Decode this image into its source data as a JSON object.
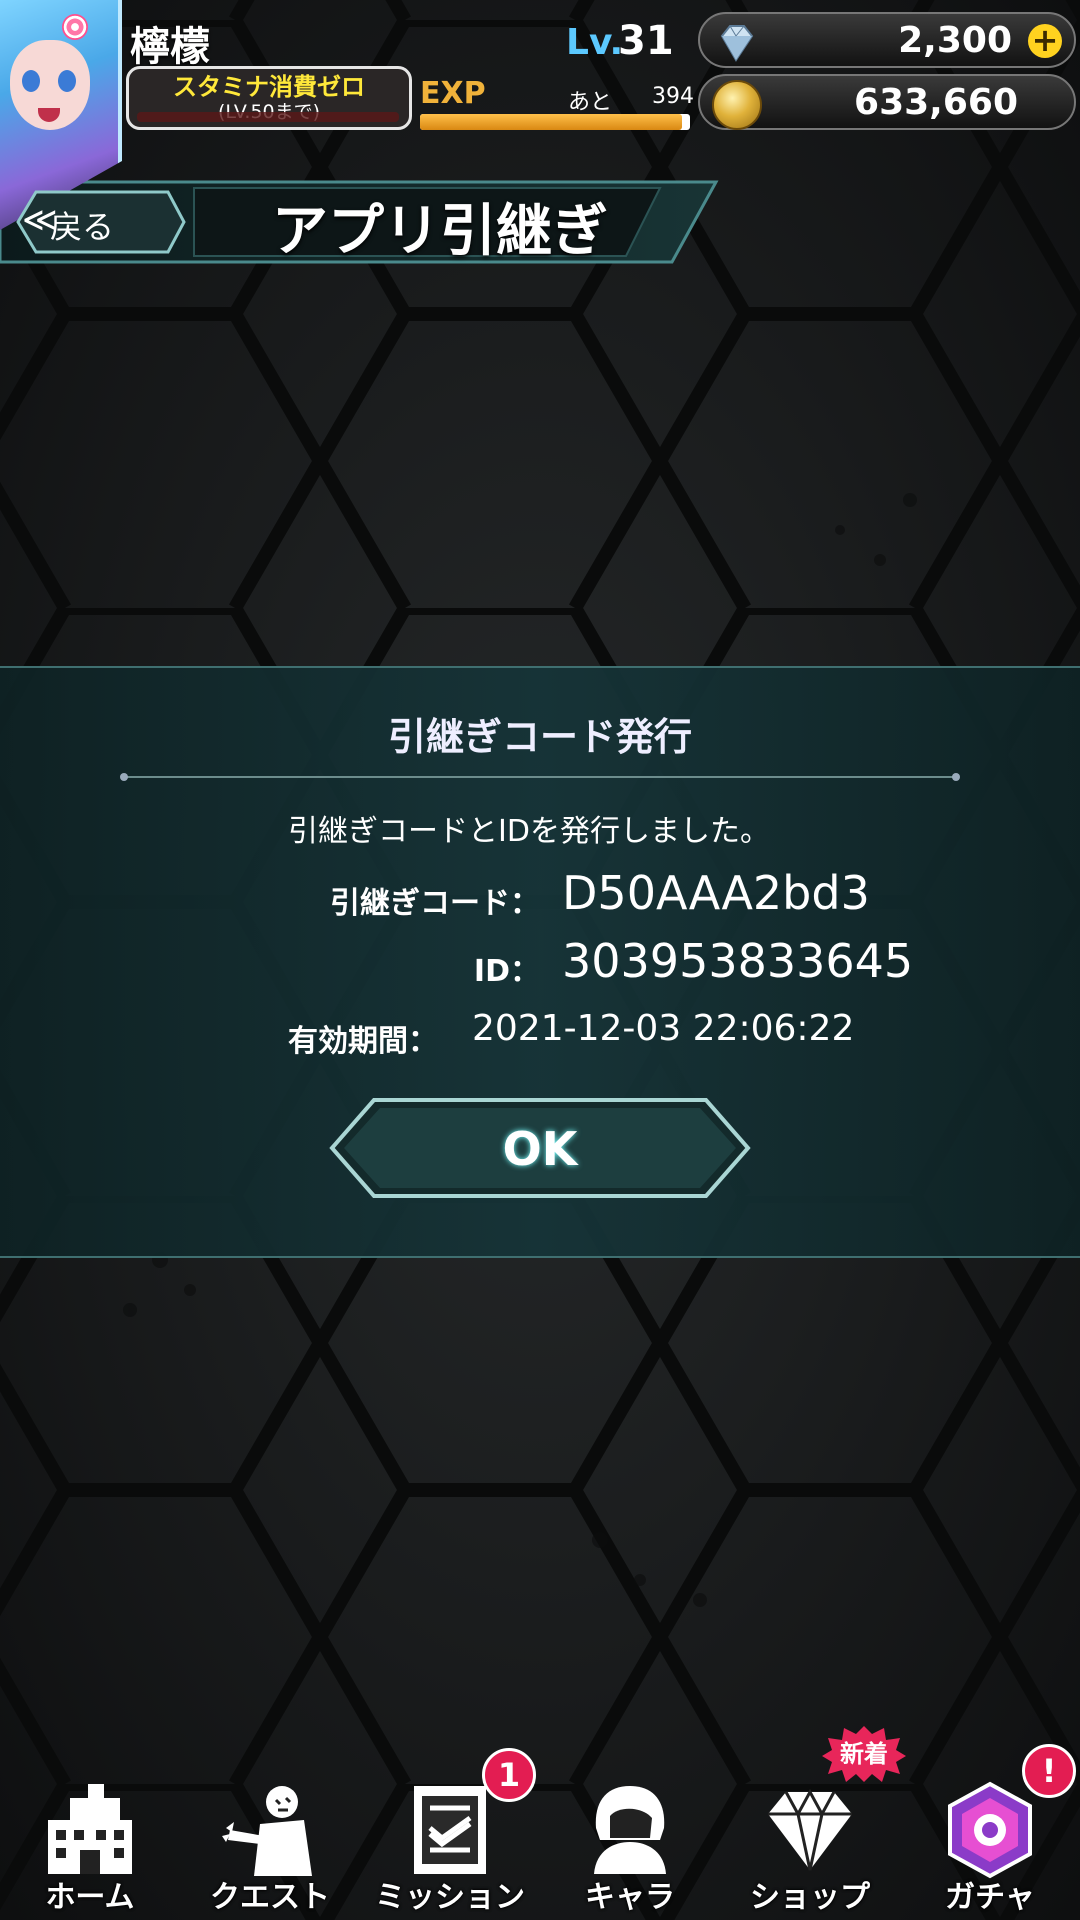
{
  "header": {
    "player_name": "檸檬",
    "level_label": "Lv.",
    "level_value": "31",
    "stamina_line1": "スタミナ消費ゼロ",
    "stamina_line2": "(LV.50まで)",
    "exp_label": "EXP",
    "exp_remaining_label": "あと",
    "exp_remaining_value": "394",
    "exp_progress": 0.97,
    "gems": "2,300",
    "coins": "633,660"
  },
  "title_bar": {
    "back_chevron": "≪",
    "back_label": "戻る",
    "title": "アプリ引継ぎ"
  },
  "dialog": {
    "title": "引継ぎコード発行",
    "message": "引継ぎコードとIDを発行しました。",
    "code_label": "引継ぎコード：",
    "code_value": "D50AAA2bd3",
    "id_label": "ID：",
    "id_value": "303953833645",
    "expiry_label": "有効期間：",
    "expiry_value": "2021-12-03  22:06:22",
    "ok_label": "OK"
  },
  "nav": {
    "items": [
      {
        "label": "ホーム",
        "icon": "building-icon"
      },
      {
        "label": "クエスト",
        "icon": "zombie-icon"
      },
      {
        "label": "ミッション",
        "icon": "checklist-icon",
        "badge": "1"
      },
      {
        "label": "キャラ",
        "icon": "character-icon"
      },
      {
        "label": "ショップ",
        "icon": "diamond-icon",
        "badge": "新着"
      },
      {
        "label": "ガチャ",
        "icon": "gacha-icon",
        "badge": "!"
      }
    ]
  },
  "colors": {
    "accent_teal": "#3f6f70",
    "level_blue": "#5cc9ff",
    "exp_orange": "#f0b23a",
    "badge_pink": "#e31d52"
  }
}
